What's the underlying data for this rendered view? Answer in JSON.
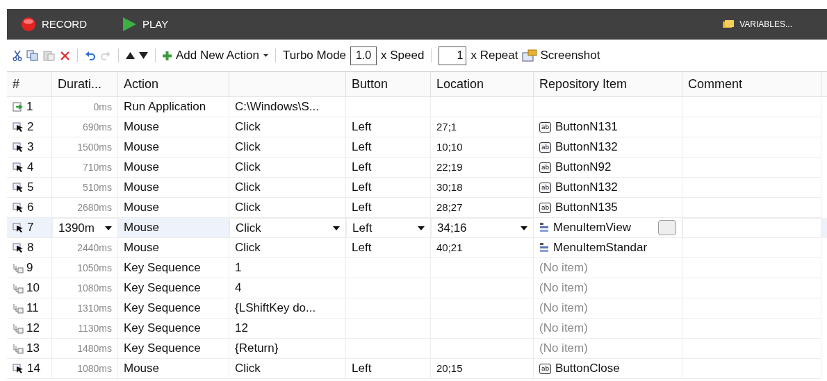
{
  "topbar": {
    "record": "RECORD",
    "play": "PLAY",
    "variables": "VARIABLES..."
  },
  "toolbar": {
    "add_action": "Add New Action",
    "turbo_label": "Turbo Mode",
    "speed_value": "1.0",
    "speed_label": "x Speed",
    "repeat_value": "1",
    "repeat_label": "x Repeat",
    "screenshot": "Screenshot",
    "redo_disabled": true
  },
  "table": {
    "columns": [
      "#",
      "Durati...",
      "Action",
      "",
      "Button",
      "Location",
      "Repository Item",
      "Comment"
    ],
    "rows": [
      {
        "kind": "run",
        "num": "1",
        "duration": "0ms",
        "action": "Run Application",
        "detail": "C:\\Windows\\S...",
        "button": "",
        "location": "",
        "selected": false
      },
      {
        "kind": "mouse",
        "num": "2",
        "duration": "690ms",
        "action": "Mouse",
        "detail": "Click",
        "button": "Left",
        "location": "27;1",
        "repo": {
          "kind": "button",
          "icon_text": "ab",
          "name": "ButtonN131"
        },
        "selected": false
      },
      {
        "kind": "mouse",
        "num": "3",
        "duration": "1500ms",
        "action": "Mouse",
        "detail": "Click",
        "button": "Left",
        "location": "10;10",
        "repo": {
          "kind": "button",
          "icon_text": "ab",
          "name": "ButtonN132"
        },
        "selected": false
      },
      {
        "kind": "mouse",
        "num": "4",
        "duration": "710ms",
        "action": "Mouse",
        "detail": "Click",
        "button": "Left",
        "location": "22;19",
        "repo": {
          "kind": "button",
          "icon_text": "ab",
          "name": "ButtonN92"
        },
        "selected": false
      },
      {
        "kind": "mouse",
        "num": "5",
        "duration": "510ms",
        "action": "Mouse",
        "detail": "Click",
        "button": "Left",
        "location": "30;18",
        "repo": {
          "kind": "button",
          "icon_text": "ab",
          "name": "ButtonN132"
        },
        "selected": false
      },
      {
        "kind": "mouse",
        "num": "6",
        "duration": "2680ms",
        "action": "Mouse",
        "detail": "Click",
        "button": "Left",
        "location": "28;27",
        "repo": {
          "kind": "button",
          "icon_text": "ab",
          "name": "ButtonN135"
        },
        "selected": false
      },
      {
        "kind": "mouse",
        "num": "7",
        "duration": "1390m",
        "action": "Mouse",
        "detail": "Click",
        "button": "Left",
        "location": "34;16",
        "repo": {
          "kind": "menu",
          "name": "MenuItemView"
        },
        "selected": true
      },
      {
        "kind": "mouse",
        "num": "8",
        "duration": "2440ms",
        "action": "Mouse",
        "detail": "Click",
        "button": "Left",
        "location": "40;21",
        "repo": {
          "kind": "menu",
          "name": "MenuItemStandar"
        },
        "selected": false
      },
      {
        "kind": "key",
        "num": "9",
        "duration": "1050ms",
        "action": "Key Sequence",
        "detail": "1",
        "button": "",
        "location": "",
        "repo": {
          "kind": "none",
          "name": "(No item)"
        },
        "selected": false
      },
      {
        "kind": "key",
        "num": "10",
        "duration": "1080ms",
        "action": "Key Sequence",
        "detail": "4",
        "button": "",
        "location": "",
        "repo": {
          "kind": "none",
          "name": "(No item)"
        },
        "selected": false
      },
      {
        "kind": "key",
        "num": "11",
        "duration": "1310ms",
        "action": "Key Sequence",
        "detail": "{LShiftKey do...",
        "button": "",
        "location": "",
        "repo": {
          "kind": "none",
          "name": "(No item)"
        },
        "selected": false
      },
      {
        "kind": "key",
        "num": "12",
        "duration": "1130ms",
        "action": "Key Sequence",
        "detail": "12",
        "button": "",
        "location": "",
        "repo": {
          "kind": "none",
          "name": "(No item)"
        },
        "selected": false
      },
      {
        "kind": "key",
        "num": "13",
        "duration": "1480ms",
        "action": "Key Sequence",
        "detail": "{Return}",
        "button": "",
        "location": "",
        "repo": {
          "kind": "none",
          "name": "(No item)"
        },
        "selected": false
      },
      {
        "kind": "mouse",
        "num": "14",
        "duration": "1080ms",
        "action": "Mouse",
        "detail": "Click",
        "button": "Left",
        "location": "20;15",
        "repo": {
          "kind": "button",
          "icon_text": "ab",
          "name": "ButtonClose"
        },
        "selected": false
      }
    ]
  }
}
